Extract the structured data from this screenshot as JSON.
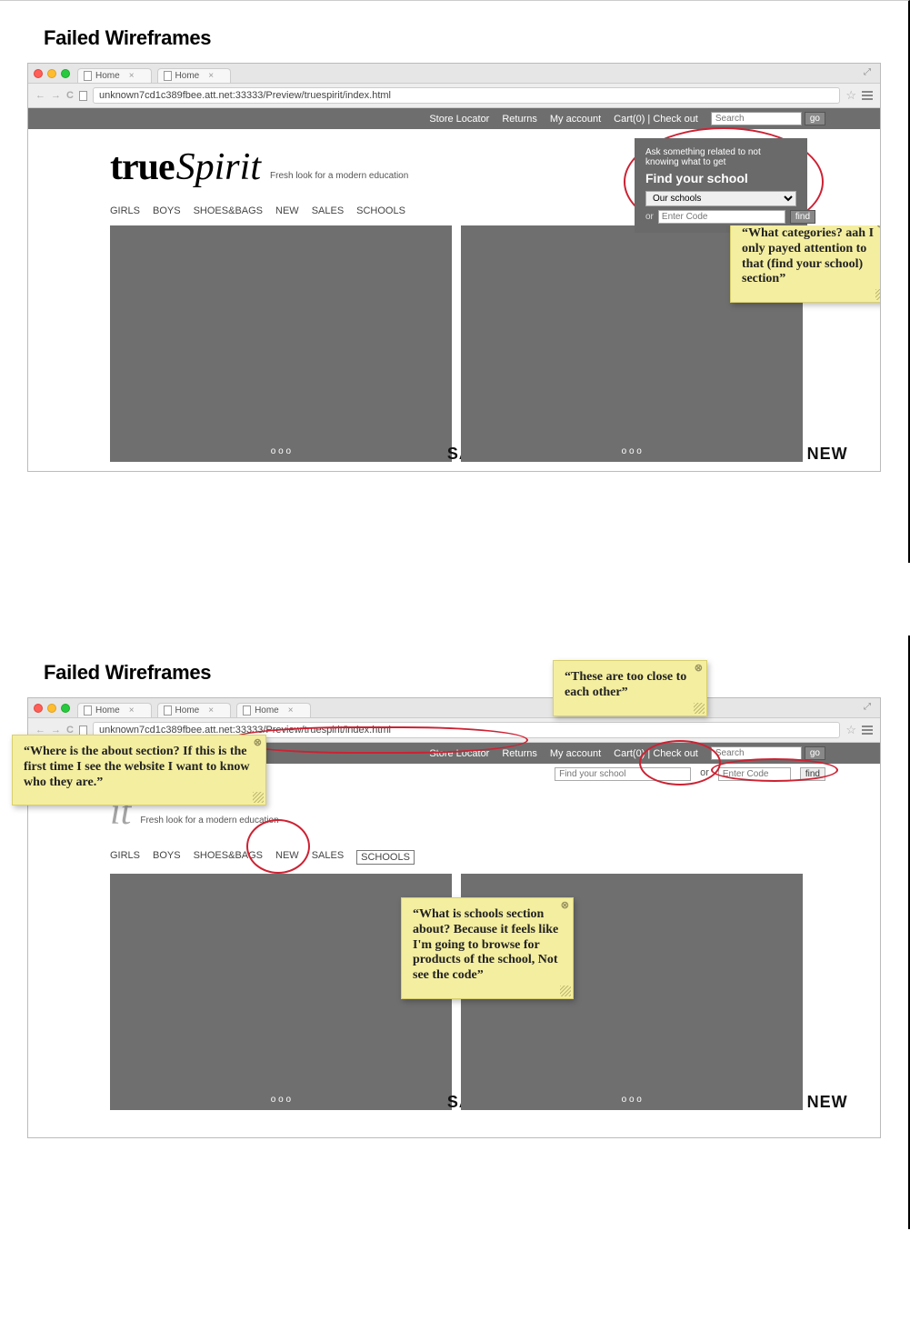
{
  "slide1": {
    "title": "Failed Wireframes",
    "browser": {
      "tabs": [
        "Home",
        "Home"
      ],
      "url": "unknown7cd1c389fbee.att.net:33333/Preview/truespirit/index.html"
    },
    "topbar": {
      "links": [
        "Store Locator",
        "Returns",
        "My account",
        "Cart(0) | Check out"
      ],
      "search_placeholder": "Search",
      "go_label": "go"
    },
    "logo": {
      "a": "true",
      "b": "Spirit"
    },
    "tagline": "Fresh look for a modern education",
    "nav": [
      "GIRLS",
      "BOYS",
      "SHOES&BAGS",
      "NEW",
      "SALES",
      "SCHOOLS"
    ],
    "find_school": {
      "hint": "Ask something related to not knowing what to get",
      "title": "Find your school",
      "dropdown": "Our schools",
      "or": "or",
      "code_placeholder": "Enter Code",
      "find_label": "find"
    },
    "hero": {
      "dots": "o o o",
      "sales_label": "SALES",
      "new_label": "NEW"
    },
    "sticky1": "“What categories? aah I only payed attention to that (find your school) section”"
  },
  "slide2": {
    "title": "Failed Wireframes",
    "browser": {
      "tabs": [
        "Home",
        "Home",
        "Home"
      ],
      "url": "unknown7cd1c389fbee.att.net:33333/Preview/truespirit/index.html"
    },
    "topbar": {
      "links": [
        "Store Locator",
        "Returns",
        "My account",
        "Cart(0) | Check out"
      ],
      "search_placeholder": "Search",
      "go_label": "go",
      "find_school_placeholder": "Find your school",
      "or": "or",
      "code_placeholder": "Enter Code",
      "find_label": "find"
    },
    "logo_b": "it",
    "tagline": "Fresh look for a modern education",
    "nav": [
      "GIRLS",
      "BOYS",
      "SHOES&BAGS",
      "NEW",
      "SALES",
      "SCHOOLS"
    ],
    "hero": {
      "dots": "o o o",
      "sales_label": "SALES",
      "new_label": "NEW"
    },
    "sticky_about": "“Where is the about section? If this is the first time I see the website I want to know who they are.”",
    "sticky_tooclose": "“These are too close to each other”",
    "sticky_schools": "“What is schools section about? Because it feels like I'm going to browse for products of the school, Not see the code”"
  }
}
